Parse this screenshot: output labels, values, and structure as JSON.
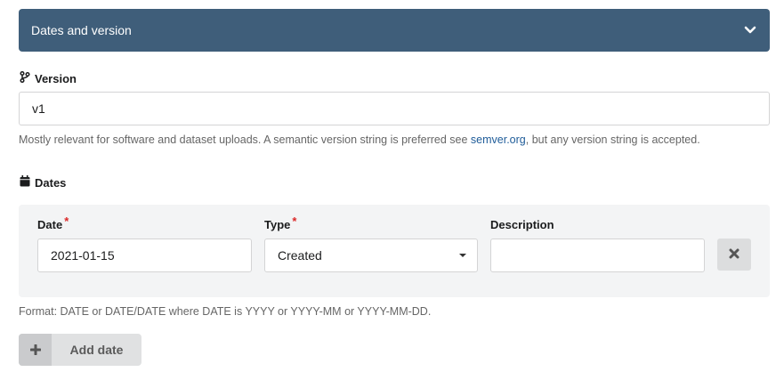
{
  "accordion": {
    "title": "Dates and version",
    "icon": "chevron-down-icon"
  },
  "version": {
    "label": "Version",
    "icon": "code-branch-icon",
    "value": "v1",
    "help_before": "Mostly relevant for software and dataset uploads. A semantic version string is preferred see ",
    "help_link": "semver.org",
    "help_after": ", but any version string is accepted."
  },
  "dates": {
    "label": "Dates",
    "icon": "calendar-icon",
    "columns": {
      "date_label": "Date",
      "type_label": "Type",
      "description_label": "Description",
      "required_marker": "*"
    },
    "row": {
      "date_value": "2021-01-15",
      "type_value": "Created",
      "description_value": ""
    },
    "remove_icon": "close-icon",
    "format_help": "Format: DATE or DATE/DATE where DATE is YYYY or YYYY-MM or YYYY-MM-DD.",
    "add_button": {
      "label": "Add date",
      "icon": "plus-icon"
    }
  },
  "colors": {
    "header_bg": "#3f5e7a",
    "link": "#1f5c99",
    "required": "#db2828",
    "panel_bg": "#f3f4f5"
  }
}
